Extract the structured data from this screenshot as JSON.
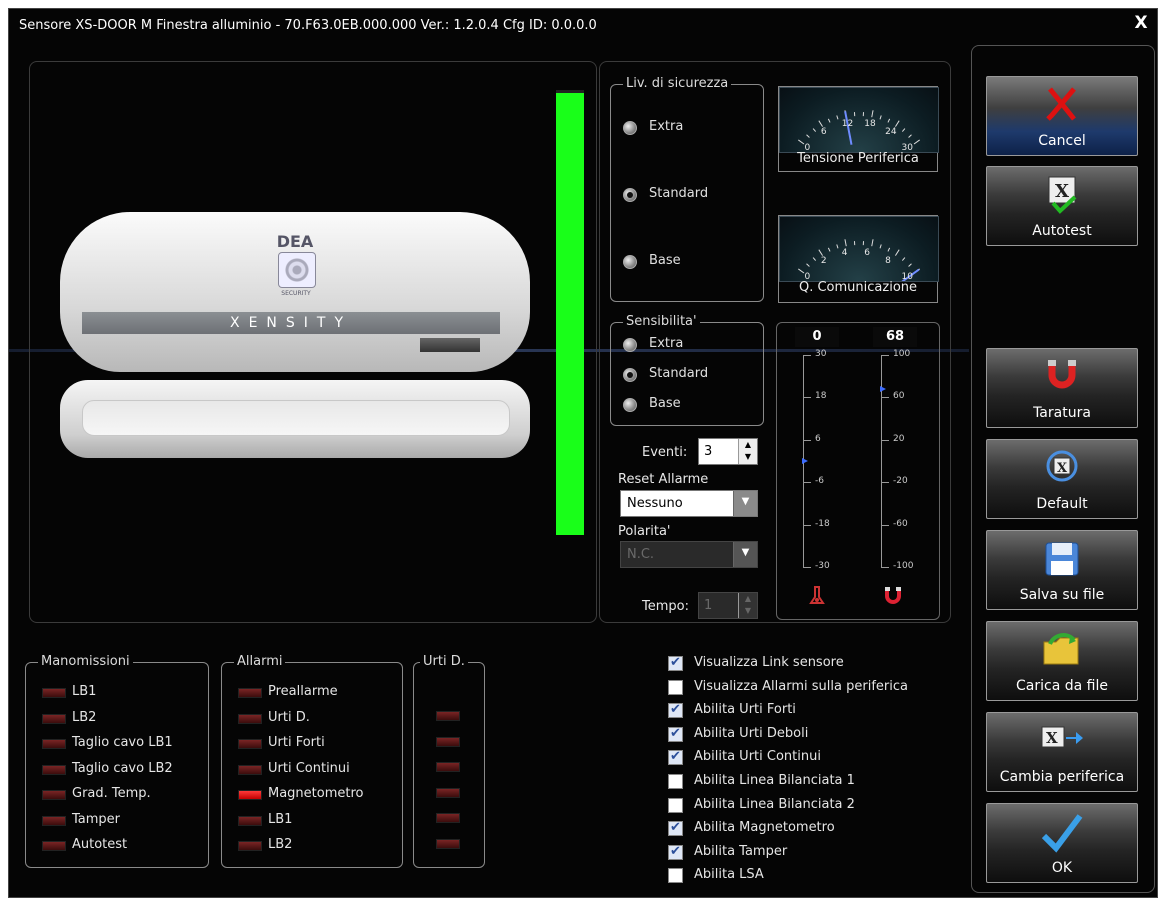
{
  "window": {
    "title": "Sensore XS-DOOR M Finestra alluminio - 70.F63.0EB.000.000 Ver.: 1.2.0.4 Cfg ID: 0.0.0.0",
    "close_glyph": "X"
  },
  "device": {
    "brand": "DEA",
    "model_label": "XENSITY",
    "badge": "SECURITY"
  },
  "signal_bar": {
    "level": 1.0,
    "color": "#19ff19"
  },
  "security_level": {
    "title": "Liv. di sicurezza",
    "options": [
      "Extra",
      "Standard",
      "Base"
    ],
    "selected": "Standard"
  },
  "sensitivity": {
    "title": "Sensibilita'",
    "options": [
      "Extra",
      "Standard",
      "Base"
    ],
    "selected": "Standard"
  },
  "gauges": [
    {
      "label": "Tensione Periferica",
      "ticks": [
        "0",
        "6",
        "12",
        "18",
        "24",
        "30"
      ],
      "value": 12
    },
    {
      "label": "Q. Comunicazione",
      "ticks": [
        "0",
        "2",
        "4",
        "6",
        "8",
        "10"
      ],
      "value": 10
    }
  ],
  "events": {
    "label": "Eventi:",
    "value": "3"
  },
  "reset_alarm": {
    "label": "Reset Allarme",
    "value": "Nessuno"
  },
  "polarity": {
    "label": "Polarita'",
    "value": "N.C."
  },
  "time": {
    "label": "Tempo:",
    "value": "1"
  },
  "scales": {
    "temperature": {
      "readout": "0",
      "ticks": [
        "30",
        "18",
        "6",
        "-6",
        "-18",
        "-30"
      ],
      "marker_value": 0,
      "range": [
        -30,
        30
      ]
    },
    "magnet": {
      "readout": "68",
      "ticks": [
        "100",
        "60",
        "20",
        "-20",
        "-60",
        "-100"
      ],
      "marker_value": 68,
      "range": [
        -100,
        100
      ]
    }
  },
  "buttons": [
    {
      "label": "Cancel",
      "icon": "cancel-x-icon"
    },
    {
      "label": "Autotest",
      "icon": "autotest-icon"
    },
    {
      "label": "Taratura",
      "icon": "magnet-icon"
    },
    {
      "label": "Default",
      "icon": "default-reset-icon"
    },
    {
      "label": "Salva su file",
      "icon": "floppy-disk-icon"
    },
    {
      "label": "Carica da file",
      "icon": "folder-open-icon"
    },
    {
      "label": "Cambia periferica",
      "icon": "switch-device-icon"
    },
    {
      "label": "OK",
      "icon": "checkmark-icon"
    }
  ],
  "tamper_group": {
    "title": "Manomissioni",
    "items": [
      {
        "label": "LB1",
        "on": false
      },
      {
        "label": "LB2",
        "on": false
      },
      {
        "label": "Taglio cavo LB1",
        "on": false
      },
      {
        "label": "Taglio cavo LB2",
        "on": false
      },
      {
        "label": "Grad. Temp.",
        "on": false
      },
      {
        "label": "Tamper",
        "on": false
      },
      {
        "label": "Autotest",
        "on": false
      }
    ]
  },
  "alarms_group": {
    "title": "Allarmi",
    "items": [
      {
        "label": "Preallarme",
        "on": false
      },
      {
        "label": "Urti D.",
        "on": false
      },
      {
        "label": "Urti Forti",
        "on": false
      },
      {
        "label": "Urti Continui",
        "on": false
      },
      {
        "label": "Magnetometro",
        "on": true
      },
      {
        "label": "LB1",
        "on": false
      },
      {
        "label": "LB2",
        "on": false
      }
    ]
  },
  "shocks_group": {
    "title": "Urti D.",
    "leds": [
      false,
      false,
      false,
      false,
      false,
      false
    ]
  },
  "checkboxes": [
    {
      "label": "Visualizza Link sensore",
      "checked": true
    },
    {
      "label": "Visualizza Allarmi sulla periferica",
      "checked": false
    },
    {
      "label": "Abilita Urti Forti",
      "checked": true
    },
    {
      "label": "Abilita Urti Deboli",
      "checked": true
    },
    {
      "label": "Abilita Urti Continui",
      "checked": true
    },
    {
      "label": "Abilita Linea Bilanciata 1",
      "checked": false
    },
    {
      "label": "Abilita Linea Bilanciata 2",
      "checked": false
    },
    {
      "label": "Abilita Magnetometro",
      "checked": true
    },
    {
      "label": "Abilita Tamper",
      "checked": true
    },
    {
      "label": "Abilita LSA",
      "checked": false
    }
  ]
}
